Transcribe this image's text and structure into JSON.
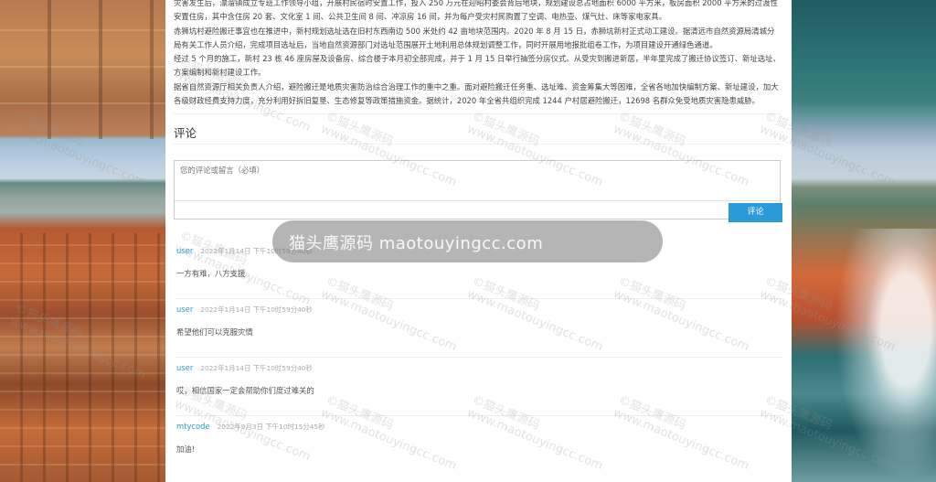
{
  "article": {
    "paragraphs": [
      "灾害发生后，漂溜镇成立专班工作领导小组，开展村民宿时安置工作，投入 250 万元在迎昭村委会背后地块，规划建设总占地面积 6000 平方米，板房面积 2000 平方米的过渡性安置住房，其中含住房 20 套、文化室 1 间、公共卫生间 8 间、冲凉房 16 间，并为每户受灾村民购置了空调、电热壶、煤气灶、床等家电家具。",
      "赤狮坑村避险搬迁事宜也在推进中，新村规划选址选在旧村东西南边 500 米处约 42 亩地块范围内。2020 年 8 月 15 日，赤狮坑新村正式动工建设。据清远市自然资源局清城分局有关工作人员介绍，完成项目选址后，当地自然资源部门对选址范围展开土地利用总体规划调整工作，同时开展用地报批组卷工作，为项目建设开通绿色通道。",
      "经过 5 个月的施工，新村 23 栋 46 座房屋及设备房、综合楼于本月初全部完成，并于 1 月 15 日举行抽签分房仪式。从受灾到搬进新居，半年里完成了搬迁协议签订、新址选址、方案编制和新村建设工作。",
      "据省自然资源厅相关负责人介绍，避险搬迁是地质灾害防治综合治理工作的重中之重。面对避险搬迁任务重、选址难、资金筹集大等困难，全省各地加快编制方案、新址建设，加大各级财政经费支持力度，充分利用好拆旧复垦、生态修复等政策措施资金。据统计，2020 年全省共组织完成 1244 户村居避险搬迁，12698 名群众免受地质灾害隐患威胁。"
    ]
  },
  "comments_section": {
    "title": "评论",
    "textarea_placeholder": "您的评论或留言（必填）",
    "submit_label": "评论"
  },
  "comments": [
    {
      "author": "user",
      "time": "2022年1月14日 下午10时59分40秒",
      "text": "一方有难，八方支援"
    },
    {
      "author": "user",
      "time": "2022年1月14日 下午10时59分40秒",
      "text": "希望他们可以克服灾情"
    },
    {
      "author": "user",
      "time": "2022年1月14日 下午10时59分40秒",
      "text": "哎，相信国家一定会帮助你们度过难关的"
    },
    {
      "author": "mtycode",
      "time": "2022年9月3日 下午10时15分45秒",
      "text": "加油!"
    }
  ],
  "watermark": {
    "brand": "©猫头鹰源码",
    "url": "www.maotouyingcc.com",
    "pill_text": "猫头鹰源码 maotouyingcc.com"
  },
  "colors": {
    "accent": "#2a9bd6",
    "author": "#2a9bd6"
  }
}
